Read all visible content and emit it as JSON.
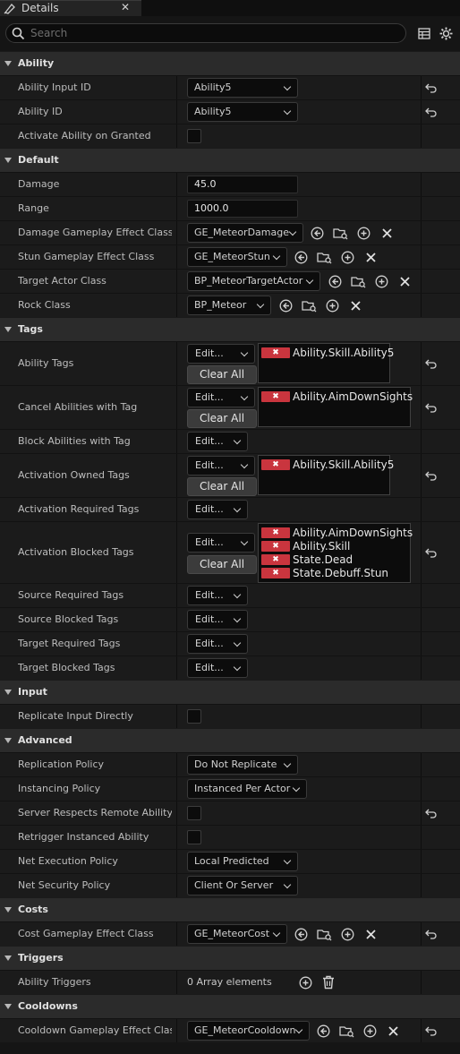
{
  "tab": {
    "title": "Details",
    "close": "✕"
  },
  "search": {
    "placeholder": "Search"
  },
  "categories": {
    "ability": "Ability",
    "default": "Default",
    "tags": "Tags",
    "input": "Input",
    "advanced": "Advanced",
    "costs": "Costs",
    "triggers": "Triggers",
    "cooldowns": "Cooldowns"
  },
  "labels": {
    "ability_input_id": "Ability Input ID",
    "ability_id": "Ability ID",
    "activate_on_granted": "Activate Ability on Granted",
    "damage": "Damage",
    "range": "Range",
    "damage_ge": "Damage Gameplay Effect Class",
    "stun_ge": "Stun Gameplay Effect Class",
    "target_actor": "Target Actor Class",
    "rock": "Rock Class",
    "ability_tags": "Ability Tags",
    "cancel_tags": "Cancel Abilities with Tag",
    "block_tags": "Block Abilities with Tag",
    "act_owned": "Activation Owned Tags",
    "act_required": "Activation Required Tags",
    "act_blocked": "Activation Blocked Tags",
    "src_required": "Source Required Tags",
    "src_blocked": "Source Blocked Tags",
    "tgt_required": "Target Required Tags",
    "tgt_blocked": "Target Blocked Tags",
    "replicate_input": "Replicate Input Directly",
    "replication_policy": "Replication Policy",
    "instancing_policy": "Instancing Policy",
    "server_respects": "Server Respects Remote Ability...",
    "retrigger": "Retrigger Instanced Ability",
    "net_exec": "Net Execution Policy",
    "net_sec": "Net Security Policy",
    "cost_ge": "Cost Gameplay Effect Class",
    "ability_triggers": "Ability Triggers",
    "cooldown_ge": "Cooldown Gameplay Effect Class"
  },
  "values": {
    "ability_input_id": "Ability5",
    "ability_id": "Ability5",
    "damage": "45.0",
    "range": "1000.0",
    "damage_ge": "GE_MeteorDamage",
    "stun_ge": "GE_MeteorStun",
    "target_actor": "BP_MeteorTargetActor",
    "rock": "BP_Meteor",
    "replication_policy": "Do Not Replicate",
    "instancing_policy": "Instanced Per Actor",
    "net_exec": "Local Predicted",
    "net_sec": "Client Or Server",
    "cost_ge": "GE_MeteorCost",
    "ability_triggers": "0 Array elements",
    "cooldown_ge": "GE_MeteorCooldown"
  },
  "tags": {
    "edit": "Edit...",
    "clear_all": "Clear All",
    "remove": "✖",
    "ability_tags": [
      "Ability.Skill.Ability5"
    ],
    "cancel_tags": [
      "Ability.AimDownSights"
    ],
    "act_owned": [
      "Ability.Skill.Ability5"
    ],
    "act_blocked": [
      "Ability.AimDownSights",
      "Ability.Skill",
      "State.Dead",
      "State.Debuff.Stun"
    ]
  }
}
